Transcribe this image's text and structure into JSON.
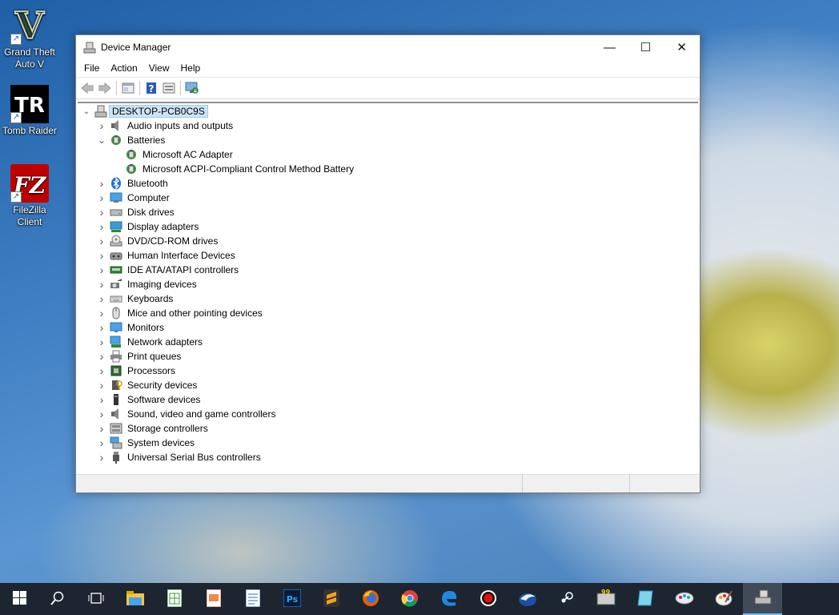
{
  "desktop": {
    "icons": [
      {
        "label": "Grand Theft Auto V",
        "icon": "gta-v-icon"
      },
      {
        "label": "Tomb Raider",
        "icon": "tomb-raider-icon"
      },
      {
        "label": "FileZilla Client",
        "icon": "filezilla-icon"
      }
    ],
    "gta_glyph": "V",
    "tr_glyph": "TR",
    "fz_glyph": "FZ"
  },
  "window": {
    "title": "Device Manager",
    "minimize": "—",
    "maximize": "☐",
    "close": "✕",
    "menu": [
      "File",
      "Action",
      "View",
      "Help"
    ],
    "toolbar": [
      "back-icon",
      "forward-icon",
      "properties-icon",
      "help-icon",
      "details-icon",
      "scan-hardware-icon"
    ],
    "tree": {
      "root": "DESKTOP-PCB0C9S",
      "categories": [
        {
          "label": "Audio inputs and outputs",
          "icon": "speaker-icon"
        },
        {
          "label": "Batteries",
          "icon": "battery-icon",
          "expanded": true,
          "children": [
            "Microsoft AC Adapter",
            "Microsoft ACPI-Compliant Control Method Battery"
          ]
        },
        {
          "label": "Bluetooth",
          "icon": "bluetooth-icon"
        },
        {
          "label": "Computer",
          "icon": "computer-icon"
        },
        {
          "label": "Disk drives",
          "icon": "disk-drive-icon"
        },
        {
          "label": "Display adapters",
          "icon": "display-adapter-icon"
        },
        {
          "label": "DVD/CD-ROM drives",
          "icon": "dvd-drive-icon"
        },
        {
          "label": "Human Interface Devices",
          "icon": "hid-icon"
        },
        {
          "label": "IDE ATA/ATAPI controllers",
          "icon": "ide-controller-icon"
        },
        {
          "label": "Imaging devices",
          "icon": "camera-icon"
        },
        {
          "label": "Keyboards",
          "icon": "keyboard-icon"
        },
        {
          "label": "Mice and other pointing devices",
          "icon": "mouse-icon"
        },
        {
          "label": "Monitors",
          "icon": "monitor-icon"
        },
        {
          "label": "Network adapters",
          "icon": "network-adapter-icon"
        },
        {
          "label": "Print queues",
          "icon": "printer-icon"
        },
        {
          "label": "Processors",
          "icon": "processor-icon"
        },
        {
          "label": "Security devices",
          "icon": "security-device-icon"
        },
        {
          "label": "Software devices",
          "icon": "software-device-icon"
        },
        {
          "label": "Sound, video and game controllers",
          "icon": "sound-controller-icon"
        },
        {
          "label": "Storage controllers",
          "icon": "storage-controller-icon"
        },
        {
          "label": "System devices",
          "icon": "system-devices-icon"
        },
        {
          "label": "Universal Serial Bus controllers",
          "icon": "usb-icon"
        }
      ]
    }
  },
  "taskbar": {
    "items": [
      "start-icon",
      "search-icon",
      "task-view-icon",
      "file-explorer-icon",
      "spreadsheet-icon",
      "presentation-icon",
      "document-icon",
      "photoshop-icon",
      "sublime-text-icon",
      "firefox-icon",
      "chrome-icon",
      "edge-icon",
      "screen-recorder-icon",
      "thunderbird-icon",
      "steam-icon",
      "monitor-tool-icon",
      "app-icon",
      "paint-icon",
      "palette-icon",
      "device-manager-icon"
    ],
    "ps_glyph": "Ps",
    "ninety_nine": "99"
  },
  "colors": {
    "selection": "#cce4f7",
    "taskbar": "#1c2530",
    "accent": "#76b9ed"
  }
}
